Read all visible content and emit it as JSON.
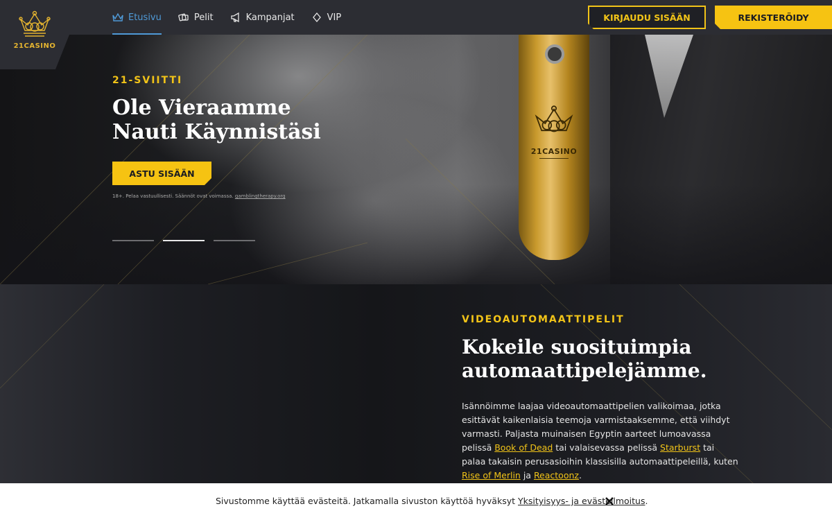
{
  "brand": {
    "name": "21CASINO",
    "accent": "#f6c312",
    "nav_active": "#4f9ad8"
  },
  "nav": [
    {
      "label": "Etusivu",
      "icon": "crown-icon",
      "active": true
    },
    {
      "label": "Pelit",
      "icon": "cards-icon",
      "active": false
    },
    {
      "label": "Kampanjat",
      "icon": "megaphone-icon",
      "active": false
    },
    {
      "label": "VIP",
      "icon": "diamond-icon",
      "active": false
    }
  ],
  "header": {
    "login_label": "KIRJAUDU SISÄÄN",
    "register_label": "REKISTERÖIDY"
  },
  "hero": {
    "kicker": "21-SVIITTI",
    "title_line1": "Ole Vieraamme",
    "title_line2": "Nauti Käynnistäsi",
    "cta_label": "ASTU SISÄÄN",
    "disclaimer_prefix": "18+. Pelaa vastuullisesti. Säännöt ovat voimassa. ",
    "disclaimer_link": "gamblingtherapy.org",
    "tag_text": "21CASINO",
    "slides": 3,
    "active_slide": 2
  },
  "section": {
    "kicker": "VIDEOAUTOMAATTIPELIT",
    "title_line1": "Kokeile suosituimpia",
    "title_line2": "automaattipelejämme.",
    "body_1": "Isännöimme laajaa videoautomaattipelien valikoimaa, jotka esittävät kaikenlaisia teemoja varmistaaksemme, että viihdyt varmasti. Paljasta muinaisen Egyptin aarteet lumoavassa pelissä ",
    "link_1": "Book of Dead",
    "body_2": " tai valaisevassa pelissä ",
    "link_2": "Starburst",
    "body_3": " tai palaa takaisin perusasioihin klassisilla automaattipeleillä, kuten ",
    "link_3": "Rise of Merlin",
    "body_4": " ja ",
    "link_4": "Reactoonz",
    "body_5": "."
  },
  "cookie": {
    "text": "Sivustomme käyttää evästeitä. Jatkamalla sivuston käyttöä hyväksyt ",
    "link": "Yksityisyys- ja evästeilmoitus",
    "suffix": "."
  }
}
